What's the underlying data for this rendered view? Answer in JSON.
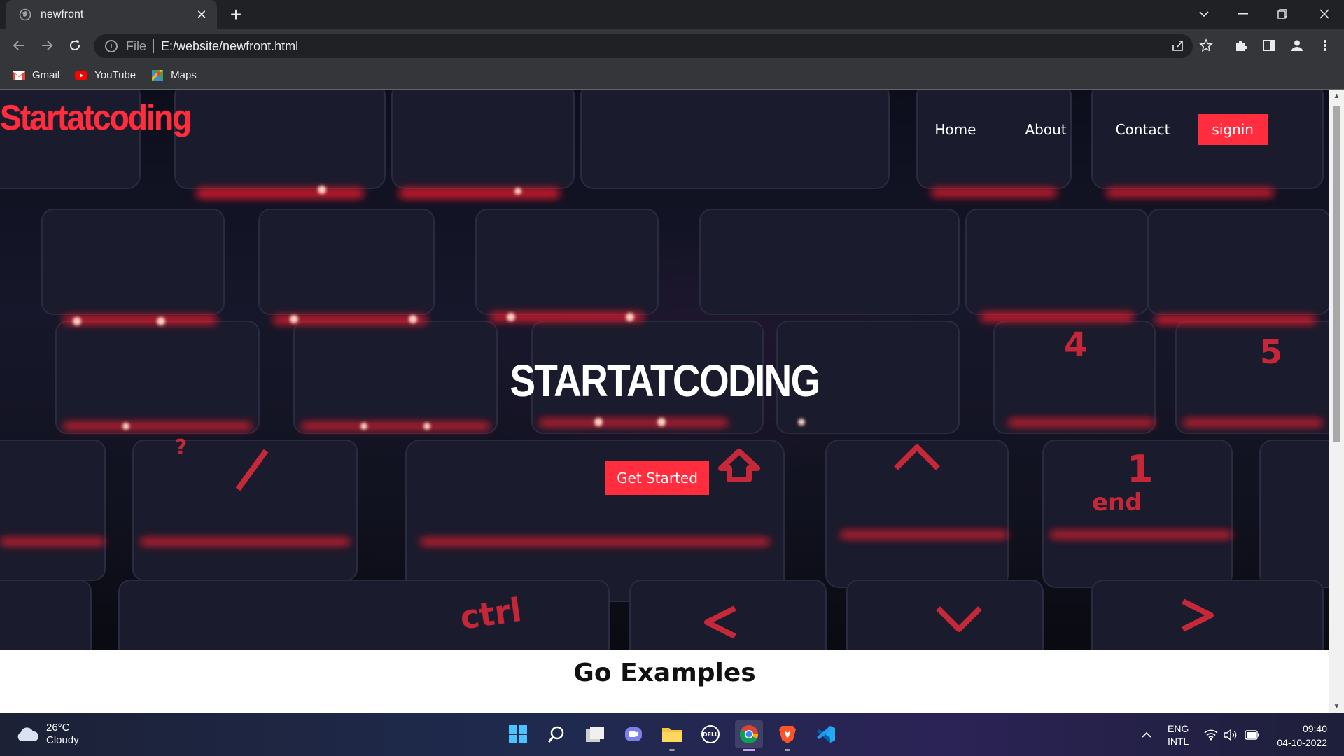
{
  "browser": {
    "tab_title": "newfront",
    "url_scheme": "File",
    "url": "E:/website/newfront.html",
    "bookmarks": [
      {
        "label": "Gmail",
        "icon": "gmail-icon"
      },
      {
        "label": "YouTube",
        "icon": "youtube-icon"
      },
      {
        "label": "Maps",
        "icon": "maps-icon"
      }
    ]
  },
  "page": {
    "logo": "Startatcoding",
    "nav": [
      "Home",
      "About",
      "Contact"
    ],
    "signin_label": "signin",
    "hero_title": "STARTATCODING",
    "cta_label": "Get Started",
    "section_title": "Go Examples"
  },
  "taskbar": {
    "weather_temp": "26°C",
    "weather_desc": "Cloudy",
    "lang_top": "ENG",
    "lang_bottom": "INTL",
    "time": "09:40",
    "date": "04-10-2022",
    "apps": [
      "start-icon",
      "search-icon",
      "task-view-icon",
      "teams-chat-icon",
      "file-explorer-icon",
      "dell-icon",
      "chrome-icon",
      "brave-icon",
      "vscode-icon"
    ]
  },
  "colors": {
    "accent": "#ff2d3d",
    "chrome_dark": "#202124",
    "chrome_mid": "#35363a"
  }
}
